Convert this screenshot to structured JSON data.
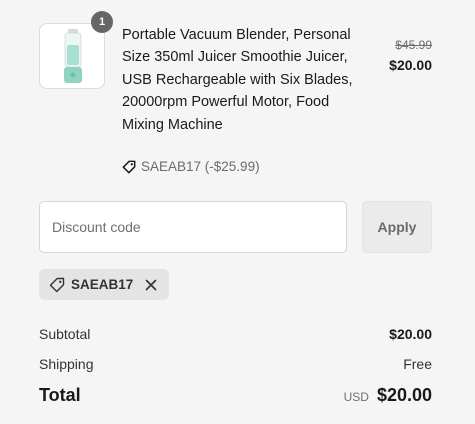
{
  "product": {
    "quantity_badge": "1",
    "title": "Portable Vacuum Blender, Personal Size 350ml Juicer Smoothie Juicer, USB Rechargeable with Six Blades, 20000rpm Powerful Motor, Food Mixing Machine",
    "discount_note": "SAEAB17 (-$25.99)",
    "price_original": "$45.99",
    "price_current": "$20.00",
    "image_icon": "blender-icon",
    "colors": {
      "blender_accent": "#8fd3c1"
    }
  },
  "discount": {
    "placeholder": "Discount code",
    "value": "",
    "apply_label": "Apply",
    "applied_code": "SAEAB17"
  },
  "summary": {
    "subtotal_label": "Subtotal",
    "subtotal_value": "$20.00",
    "shipping_label": "Shipping",
    "shipping_value": "Free",
    "total_label": "Total",
    "currency": "USD",
    "total_value": "$20.00"
  },
  "icons": {
    "tag": "tag-icon",
    "remove": "close-icon"
  }
}
